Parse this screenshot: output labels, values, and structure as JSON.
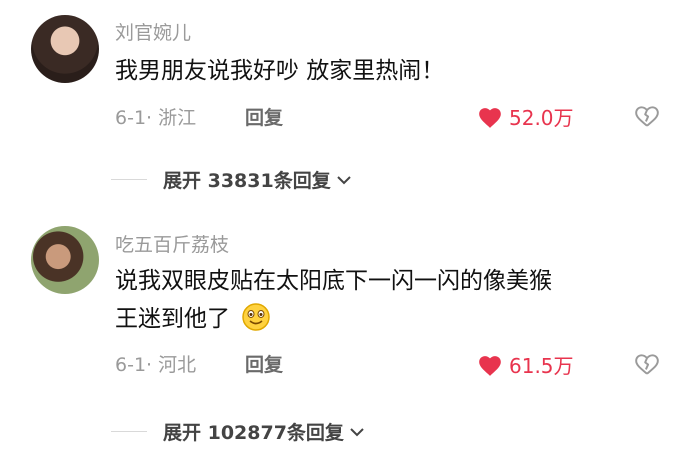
{
  "comments": [
    {
      "username": "刘官婉儿",
      "text": "我男朋友说我好吵 放家里热闹！",
      "date_location": "6-1· 浙江",
      "reply_label": "回复",
      "likes": "52.0万",
      "expand_label": "展开 33831条回复"
    },
    {
      "username": "吃五百斤荔枝",
      "text_line1": "说我双眼皮贴在太阳底下一闪一闪的像美猴",
      "text_line2": "王迷到他了",
      "date_location": "6-1· 河北",
      "reply_label": "回复",
      "likes": "61.5万",
      "expand_label": "展开 102877条回复",
      "emoji": "smiling-face-emoji"
    }
  ],
  "colors": {
    "heart": "#e8344e",
    "secondary_text": "#9a9a9a"
  },
  "icons": [
    "heart-icon",
    "broken-heart-icon",
    "chevron-down-icon"
  ]
}
